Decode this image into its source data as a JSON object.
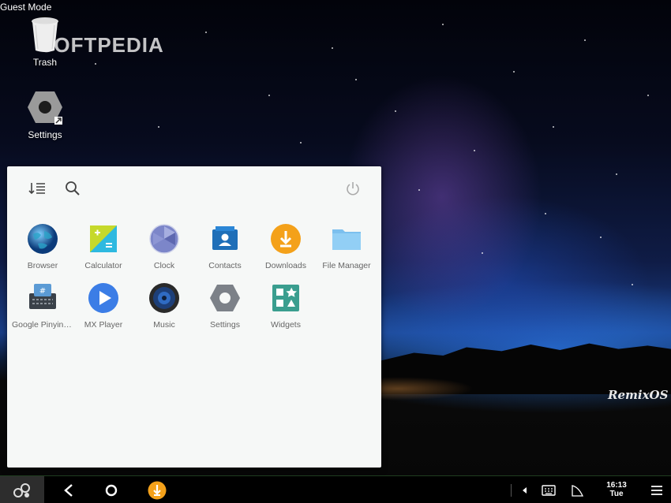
{
  "watermark": "SOFTPEDIA",
  "guest_mode": "Guest Mode",
  "desktop": {
    "trash_label": "Trash",
    "settings_label": "Settings"
  },
  "start_menu": {
    "apps": [
      {
        "label": "Browser",
        "icon": "globe-icon"
      },
      {
        "label": "Calculator",
        "icon": "calculator-icon"
      },
      {
        "label": "Clock",
        "icon": "clock-icon"
      },
      {
        "label": "Contacts",
        "icon": "contacts-icon"
      },
      {
        "label": "Downloads",
        "icon": "download-icon"
      },
      {
        "label": "File Manager",
        "icon": "folder-icon"
      },
      {
        "label": "Google Pinyin I...",
        "icon": "keyboard-icon"
      },
      {
        "label": "MX Player",
        "icon": "play-icon"
      },
      {
        "label": "Music",
        "icon": "speaker-icon"
      },
      {
        "label": "Settings",
        "icon": "gear-icon"
      },
      {
        "label": "Widgets",
        "icon": "widgets-icon"
      }
    ]
  },
  "brand_logo": "RemixOS",
  "taskbar": {
    "time": "16:13",
    "day": "Tue"
  },
  "colors": {
    "panel_bg": "#f6f8f7",
    "downloads_orange": "#f4a11a",
    "mx_blue": "#3b7de6",
    "widgets_teal": "#3a9e8f"
  }
}
